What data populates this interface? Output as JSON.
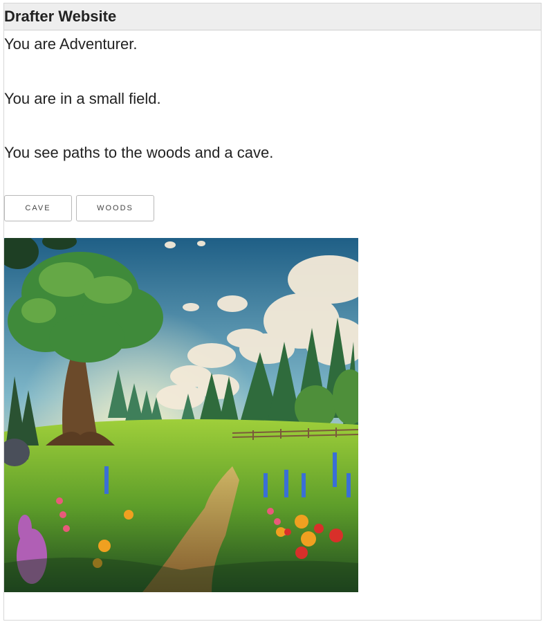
{
  "header": {
    "title": "Drafter Website"
  },
  "main": {
    "lines": [
      "You are Adventurer.",
      "You are in a small field.",
      "You see paths to the woods and a cave."
    ],
    "buttons": [
      {
        "label": "CAVE"
      },
      {
        "label": "WOODS"
      }
    ]
  },
  "image": {
    "description_icon": "meadow-scene-image"
  }
}
